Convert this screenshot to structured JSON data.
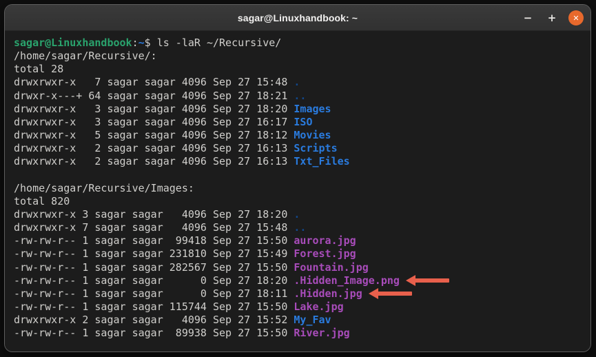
{
  "colors": {
    "term-bg": "#1c1c1c",
    "titlebar-top": "#3a3a3a",
    "titlebar-bottom": "#313131",
    "title-fg": "#f2f1f0",
    "fg": "#d0cfcc",
    "green": "#2aa36d",
    "blue": "#2a7bde",
    "blue-dim": "#12488b",
    "magenta": "#a84cba",
    "arrow": "#e8604c",
    "close-bg": "#e8692c"
  },
  "window": {
    "title": "sagar@Linuxhandbook: ~",
    "controls": {
      "minimize": "−",
      "maximize": "+",
      "close": "✕"
    }
  },
  "terminal": {
    "prompt_user": "sagar@Linuxhandbook",
    "command": "ls -laR ~/Recursive/",
    "lines": [
      {
        "segments": [
          {
            "text": "sagar@Linuxhandbook",
            "style": "prompt-user",
            "name": "prompt-user"
          },
          {
            "text": ":",
            "style": "fg",
            "name": "prompt-separator"
          },
          {
            "text": "~",
            "style": "prompt-path",
            "name": "prompt-path"
          },
          {
            "text": "$ ls -laR ~/Recursive/",
            "style": "fg",
            "name": "command-text"
          }
        ]
      },
      {
        "segments": [
          {
            "text": "/home/sagar/Recursive/:",
            "style": "fg",
            "name": "dir-header"
          }
        ]
      },
      {
        "segments": [
          {
            "text": "total 28",
            "style": "fg",
            "name": "total-line"
          }
        ]
      },
      {
        "segments": [
          {
            "text": "drwxrwxr-x   7 sagar sagar 4096 Sep 27 15:48 ",
            "style": "fg",
            "name": "file-meta"
          },
          {
            "text": ".",
            "style": "dir-dim",
            "name": "dir-name"
          }
        ]
      },
      {
        "segments": [
          {
            "text": "drwxr-x---+ 64 sagar sagar 4096 Sep 27 18:21 ",
            "style": "fg",
            "name": "file-meta"
          },
          {
            "text": "..",
            "style": "dir-dim",
            "name": "dir-name"
          }
        ]
      },
      {
        "segments": [
          {
            "text": "drwxrwxr-x   3 sagar sagar 4096 Sep 27 18:20 ",
            "style": "fg",
            "name": "file-meta"
          },
          {
            "text": "Images",
            "style": "dir",
            "name": "dir-name"
          }
        ]
      },
      {
        "segments": [
          {
            "text": "drwxrwxr-x   3 sagar sagar 4096 Sep 27 16:17 ",
            "style": "fg",
            "name": "file-meta"
          },
          {
            "text": "ISO",
            "style": "dir",
            "name": "dir-name"
          }
        ]
      },
      {
        "segments": [
          {
            "text": "drwxrwxr-x   5 sagar sagar 4096 Sep 27 18:12 ",
            "style": "fg",
            "name": "file-meta"
          },
          {
            "text": "Movies",
            "style": "dir",
            "name": "dir-name"
          }
        ]
      },
      {
        "segments": [
          {
            "text": "drwxrwxr-x   2 sagar sagar 4096 Sep 27 16:13 ",
            "style": "fg",
            "name": "file-meta"
          },
          {
            "text": "Scripts",
            "style": "dir",
            "name": "dir-name"
          }
        ]
      },
      {
        "segments": [
          {
            "text": "drwxrwxr-x   2 sagar sagar 4096 Sep 27 16:13 ",
            "style": "fg",
            "name": "file-meta"
          },
          {
            "text": "Txt_Files",
            "style": "dir",
            "name": "dir-name"
          }
        ]
      },
      {
        "segments": []
      },
      {
        "segments": [
          {
            "text": "/home/sagar/Recursive/Images:",
            "style": "fg",
            "name": "dir-header"
          }
        ]
      },
      {
        "segments": [
          {
            "text": "total 820",
            "style": "fg",
            "name": "total-line"
          }
        ]
      },
      {
        "segments": [
          {
            "text": "drwxrwxr-x 3 sagar sagar   4096 Sep 27 18:20 ",
            "style": "fg",
            "name": "file-meta"
          },
          {
            "text": ".",
            "style": "dir-dim",
            "name": "dir-name"
          }
        ]
      },
      {
        "segments": [
          {
            "text": "drwxrwxr-x 7 sagar sagar   4096 Sep 27 15:48 ",
            "style": "fg",
            "name": "file-meta"
          },
          {
            "text": "..",
            "style": "dir-dim",
            "name": "dir-name"
          }
        ]
      },
      {
        "segments": [
          {
            "text": "-rw-rw-r-- 1 sagar sagar  99418 Sep 27 15:50 ",
            "style": "fg",
            "name": "file-meta"
          },
          {
            "text": "aurora.jpg",
            "style": "media",
            "name": "file-name"
          }
        ]
      },
      {
        "segments": [
          {
            "text": "-rw-rw-r-- 1 sagar sagar 231810 Sep 27 15:49 ",
            "style": "fg",
            "name": "file-meta"
          },
          {
            "text": "Forest.jpg",
            "style": "media",
            "name": "file-name"
          }
        ]
      },
      {
        "segments": [
          {
            "text": "-rw-rw-r-- 1 sagar sagar 282567 Sep 27 15:50 ",
            "style": "fg",
            "name": "file-meta"
          },
          {
            "text": "Fountain.jpg",
            "style": "media",
            "name": "file-name"
          }
        ]
      },
      {
        "segments": [
          {
            "text": "-rw-rw-r-- 1 sagar sagar      0 Sep 27 18:20 ",
            "style": "fg",
            "name": "file-meta"
          },
          {
            "text": ".Hidden_Image.png",
            "style": "media",
            "name": "file-name"
          }
        ],
        "arrow": true
      },
      {
        "segments": [
          {
            "text": "-rw-rw-r-- 1 sagar sagar      0 Sep 27 18:11 ",
            "style": "fg",
            "name": "file-meta"
          },
          {
            "text": ".Hidden.jpg",
            "style": "media",
            "name": "file-name"
          }
        ],
        "arrow": true
      },
      {
        "segments": [
          {
            "text": "-rw-rw-r-- 1 sagar sagar 115744 Sep 27 15:50 ",
            "style": "fg",
            "name": "file-meta"
          },
          {
            "text": "Lake.jpg",
            "style": "media",
            "name": "file-name"
          }
        ]
      },
      {
        "segments": [
          {
            "text": "drwxrwxr-x 2 sagar sagar   4096 Sep 27 15:52 ",
            "style": "fg",
            "name": "file-meta"
          },
          {
            "text": "My_Fav",
            "style": "dir",
            "name": "dir-name"
          }
        ]
      },
      {
        "segments": [
          {
            "text": "-rw-rw-r-- 1 sagar sagar  89938 Sep 27 15:50 ",
            "style": "fg",
            "name": "file-meta"
          },
          {
            "text": "River.jpg",
            "style": "media",
            "name": "file-name"
          }
        ]
      }
    ]
  }
}
